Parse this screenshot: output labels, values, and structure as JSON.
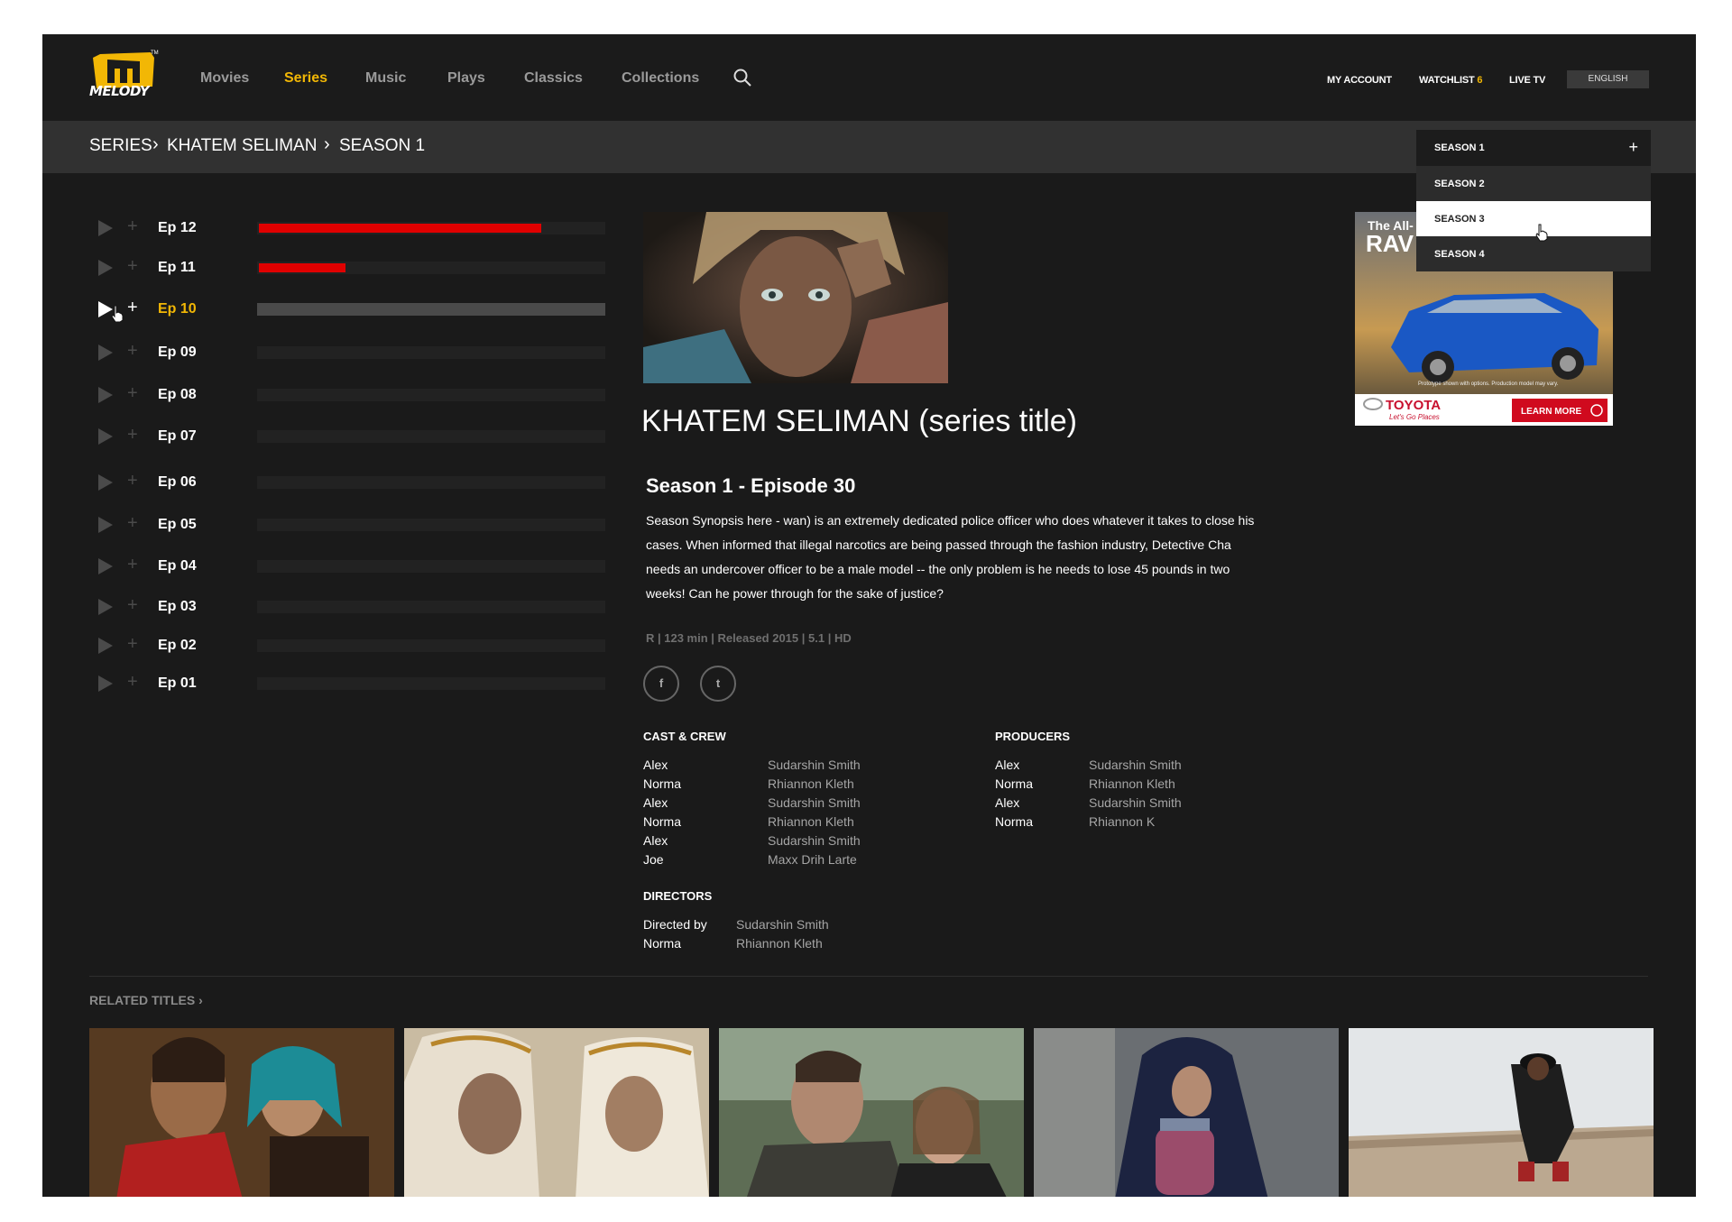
{
  "brand": {
    "logo_text": "MELODY",
    "accent": "#f2b705",
    "progress_color": "#e00000"
  },
  "nav": {
    "items": [
      "Movies",
      "Series",
      "Music",
      "Plays",
      "Classics",
      "Collections"
    ],
    "active": "Series",
    "search_icon": "search-icon"
  },
  "utility": {
    "account": "MY ACCOUNT",
    "watchlist": "WATCHLIST",
    "watchlist_count": "6",
    "live_tv": "LIVE TV",
    "language": "ENGLISH"
  },
  "breadcrumb": [
    "SERIES",
    "KHATEM SELIMAN",
    "SEASON 1"
  ],
  "season_select": {
    "selected": "SEASON 1",
    "options": [
      "SEASON 2",
      "SEASON 3",
      "SEASON 4"
    ],
    "hovered": "SEASON 3"
  },
  "episodes": [
    {
      "label": "Ep 12",
      "progress": 0.82
    },
    {
      "label": "Ep 11",
      "progress": 0.25
    },
    {
      "label": "Ep 10",
      "progress": 0,
      "active": true
    },
    {
      "label": "Ep 09",
      "progress": 0
    },
    {
      "label": "Ep 08",
      "progress": 0
    },
    {
      "label": "Ep 07",
      "progress": 0
    },
    {
      "label": "Ep 06",
      "progress": 0
    },
    {
      "label": "Ep 05",
      "progress": 0
    },
    {
      "label": "Ep 04",
      "progress": 0
    },
    {
      "label": "Ep 03",
      "progress": 0
    },
    {
      "label": "Ep 02",
      "progress": 0
    },
    {
      "label": "Ep 01",
      "progress": 0
    }
  ],
  "detail": {
    "series_title": "KHATEM SELIMAN (series title)",
    "episode_heading": "Season 1  - Episode 30",
    "synopsis": "Season Synopsis here - wan) is an extremely dedicated police officer who does whatever it takes to close his cases. When informed that illegal narcotics are being passed through the fashion industry, Detective Cha needs an undercover officer to be a male model -- the only problem is he needs to lose 45 pounds in two weeks! Can he power through for the sake of justice?",
    "meta": "R | 123 min | Released 2015 | 5.1 | HD",
    "social": [
      {
        "icon": "facebook-icon",
        "glyph": "f"
      },
      {
        "icon": "twitter-icon",
        "glyph": "t"
      }
    ]
  },
  "cast_crew": {
    "heading": "CAST & CREW",
    "rows": [
      [
        "Alex",
        "Sudarshin Smith"
      ],
      [
        "Norma",
        "Rhiannon Kleth"
      ],
      [
        "Alex",
        "Sudarshin Smith"
      ],
      [
        "Norma",
        "Rhiannon Kleth"
      ],
      [
        "Alex",
        "Sudarshin Smith"
      ],
      [
        "Joe",
        "Maxx Drih Larte"
      ]
    ]
  },
  "producers": {
    "heading": "PRODUCERS",
    "rows": [
      [
        "Alex",
        "Sudarshin Smith"
      ],
      [
        "Norma",
        "Rhiannon Kleth"
      ],
      [
        "Alex",
        "Sudarshin Smith"
      ],
      [
        "Norma",
        "Rhiannon K"
      ]
    ]
  },
  "directors": {
    "heading": "DIRECTORS",
    "rows": [
      [
        "Directed by",
        "Sudarshin Smith"
      ],
      [
        "Norma",
        "Rhiannon Kleth"
      ]
    ]
  },
  "ad": {
    "headline": "The All-",
    "model": "RAV",
    "brand": "TOYOTA",
    "tagline": "Let's Go Places",
    "cta": "LEARN MORE",
    "fineprint": "Prototype shown with options. Production model may vary."
  },
  "related": {
    "heading": "RELATED  TITLES"
  }
}
